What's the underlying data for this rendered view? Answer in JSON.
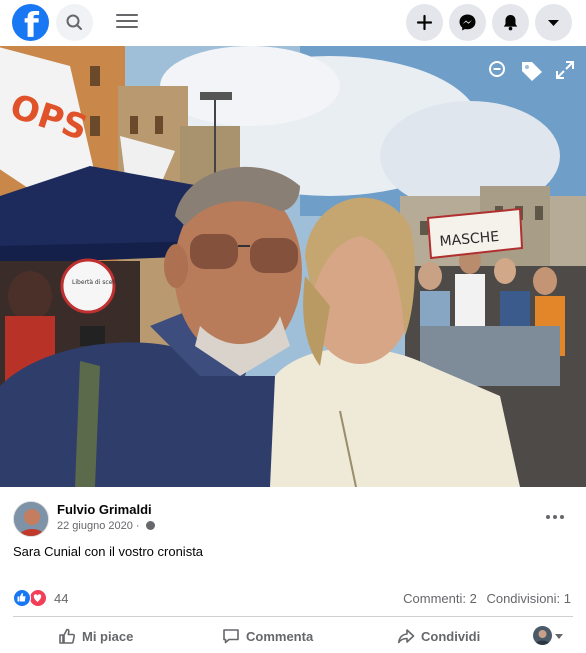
{
  "topbar": {
    "logo": "f",
    "icons": [
      "facebook-logo",
      "search-icon",
      "menu-icon",
      "plus-icon",
      "messenger-icon",
      "bell-icon",
      "chevron-down-icon"
    ]
  },
  "photo": {
    "overlay_icons": [
      "zoom-out-icon",
      "tag-icon",
      "fullscreen-icon"
    ],
    "flag_text": "OPS",
    "sign_text": "MASCHE",
    "banner_text": "Libertà di scelta"
  },
  "post": {
    "author": "Fulvio Grimaldi",
    "date": "22 giugno 2020 ·",
    "caption": "Sara Cunial con il vostro cronista"
  },
  "reactions": {
    "count": "44",
    "comments": "Commenti: 2",
    "shares": "Condivisioni: 1"
  },
  "actions": {
    "like": "Mi piace",
    "comment": "Commenta",
    "share": "Condividi"
  },
  "colors": {
    "brand": "#1877f2",
    "love": "#f33e58",
    "secondary_text": "#65676b"
  }
}
